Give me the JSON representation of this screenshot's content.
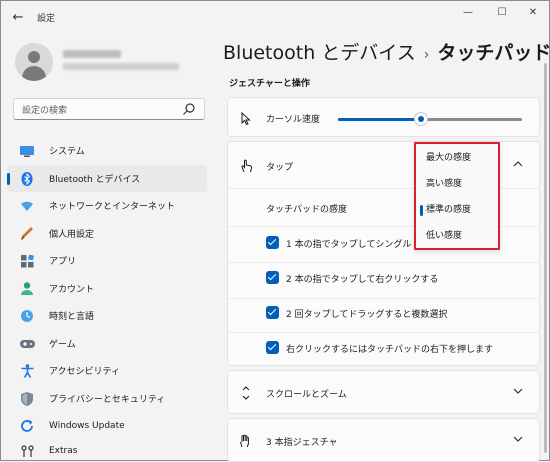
{
  "window": {
    "title": "設定",
    "minimize": "—",
    "maximize": "☐",
    "close": "✕",
    "back": "←"
  },
  "search": {
    "placeholder": "設定の検索"
  },
  "sidebar": {
    "items": [
      {
        "label": "システム",
        "icon": "system-icon"
      },
      {
        "label": "Bluetooth とデバイス",
        "icon": "bluetooth-icon",
        "selected": true
      },
      {
        "label": "ネットワークとインターネット",
        "icon": "network-icon"
      },
      {
        "label": "個人用設定",
        "icon": "personalization-icon"
      },
      {
        "label": "アプリ",
        "icon": "apps-icon"
      },
      {
        "label": "アカウント",
        "icon": "account-icon"
      },
      {
        "label": "時刻と言語",
        "icon": "time-language-icon"
      },
      {
        "label": "ゲーム",
        "icon": "gaming-icon"
      },
      {
        "label": "アクセシビリティ",
        "icon": "accessibility-icon"
      },
      {
        "label": "プライバシーとセキュリティ",
        "icon": "privacy-icon"
      },
      {
        "label": "Windows Update",
        "icon": "windows-update-icon"
      },
      {
        "label": "Extras",
        "icon": "extras-icon"
      }
    ]
  },
  "header": {
    "parent": "Bluetooth とデバイス",
    "separator": "›",
    "current": "タッチパッド"
  },
  "section": {
    "title": "ジェスチャーと操作"
  },
  "cursor_speed": {
    "label": "カーソル速度",
    "value_fraction": 0.45,
    "icon": "cursor-icon"
  },
  "tap": {
    "label": "タップ",
    "icon": "tap-icon",
    "sensitivity_label": "タッチパッドの感度",
    "options": [
      {
        "label": "1 本の指でタップしてシングル クリックする",
        "checked": true
      },
      {
        "label": "2 本の指でタップして右クリックする",
        "checked": true
      },
      {
        "label": "2 回タップしてドラッグすると複数選択",
        "checked": true
      },
      {
        "label": "右クリックするにはタッチパッドの右下を押します",
        "checked": true
      }
    ]
  },
  "sensitivity_dropdown": {
    "options": [
      "最大の感度",
      "高い感度",
      "標準の感度",
      "低い感度"
    ],
    "selected": "標準の感度",
    "highlight_color": "#d9202c"
  },
  "scroll_zoom": {
    "label": "スクロールとズーム",
    "icon": "scroll-icon"
  },
  "three_finger": {
    "label": "3 本指ジェスチャ",
    "icon": "three-finger-icon"
  },
  "colors": {
    "accent": "#005fb8",
    "background": "#f3f3f3"
  }
}
